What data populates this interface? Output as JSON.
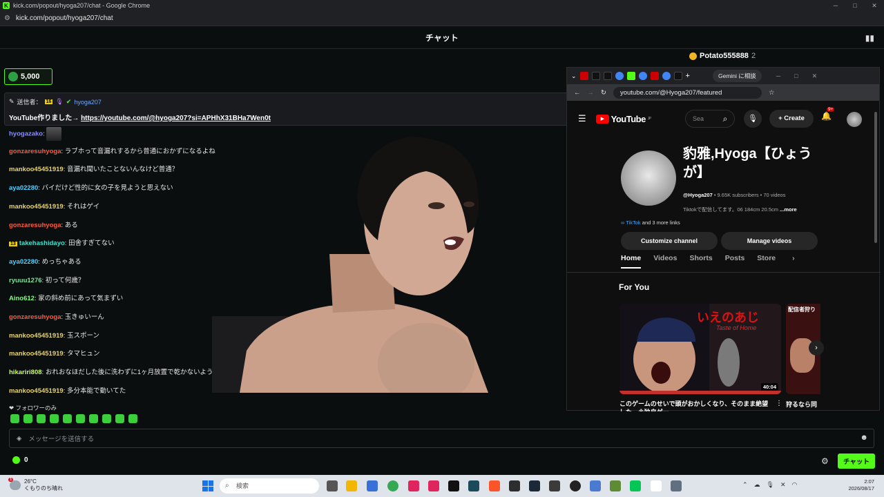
{
  "window": {
    "title": "kick.com/popout/hyoga207/chat - Google Chrome",
    "url": "kick.com/popout/hyoga207/chat",
    "controls": [
      "─",
      "□",
      "✕"
    ]
  },
  "chat": {
    "header": "チャット",
    "top_gifter": {
      "name": "Potato555888",
      "count": "2"
    },
    "kicks_balance": "5,000",
    "pinned": {
      "label": "送信者：",
      "badge": "16",
      "user": "hyoga207",
      "text": "YouTube作りました→ ",
      "link": "https://youtube.com/@hyoga207?si=APHhX31BHa7Wen0t"
    },
    "messages": [
      {
        "user": "hyogazako",
        "color": "#8c8cff",
        "text": ""
      },
      {
        "user": "gonzaresuhyoga",
        "color": "#ff5a3d",
        "text": "ラブホって音漏れするから普通におかずになるよね"
      },
      {
        "user": "mankoo45451919",
        "color": "#e8d36a",
        "text": "音漏れ聞いたことないんなけど普通？"
      },
      {
        "user": "aya02280",
        "color": "#4fd1ff",
        "text": "バイだけど性的に女の子を見ようと思えない"
      },
      {
        "user": "mankoo45451919",
        "color": "#e8d36a",
        "text": "それはゲイ"
      },
      {
        "user": "gonzaresuhyoga",
        "color": "#ff5a3d",
        "text": "ある"
      },
      {
        "user": "takehashidayo",
        "color": "#40e0d0",
        "badge": "13",
        "text": "田舎すぎてない"
      },
      {
        "user": "aya02280",
        "color": "#4fd1ff",
        "text": "めっちゃある"
      },
      {
        "user": "ryuuu1276",
        "color": "#7fe3a0",
        "text": "初って何歳？"
      },
      {
        "user": "Aino612",
        "color": "#7bff7b",
        "text": "家の斜め前にあって気まずい"
      },
      {
        "user": "gonzaresuhyoga",
        "color": "#ff5a3d",
        "text": "玉きゅいーん"
      },
      {
        "user": "mankoo45451919",
        "color": "#e8d36a",
        "text": "玉スポーン"
      },
      {
        "user": "mankoo45451919",
        "color": "#e8d36a",
        "text": "タマヒュン"
      },
      {
        "user": "hikariri808",
        "color": "#c8ff6a",
        "text": "おれおなほだした後に洗わずに1ヶ月放置で乾かないよう"
      },
      {
        "user": "mankoo45451919",
        "color": "#e8d36a",
        "text": "多分本能で動いてた"
      }
    ],
    "followers_only": "❤ フォロワーのみ",
    "input_placeholder": "メッセージを送信する",
    "points": "0",
    "send_label": "チャット"
  },
  "youtube_window": {
    "gemini_label": "Gemini に相談",
    "url": "youtube.com/@Hyoga207/featured",
    "logo": "YouTube",
    "logo_sup": "JP",
    "search_placeholder": "Sea",
    "create_label": "Create",
    "notif_count": "9+",
    "channel": {
      "name": "豹雅,Hyoga【ひょうが】",
      "handle": "@Hyoga207",
      "stats": " • 9.65K subscribers • 70 videos",
      "description": "Tiktokで配信してます。06 184cm 20.5cm ",
      "more": "...more",
      "link_main": "TikTok",
      "link_more": " and 3 more links"
    },
    "buttons": {
      "customize": "Customize channel",
      "manage": "Manage videos"
    },
    "tabs": [
      "Home",
      "Videos",
      "Shorts",
      "Posts",
      "Store"
    ],
    "section": "For You",
    "video1": {
      "title": "このゲームのせいで頭がおかしくなり、そのまま絶望した…※独自ゲー",
      "duration": "40:04",
      "thumb_text": "いえのあじ",
      "thumb_sub": "Taste of Home"
    },
    "video2": {
      "title": "狩るなら同",
      "thumb_text": "配信者狩り"
    }
  },
  "taskbar": {
    "weather_temp": "26°C",
    "weather_desc": "くもりのち晴れ",
    "weather_badge": "1",
    "search_label": "検索",
    "time": "2:07",
    "date": "2026/08/17"
  }
}
